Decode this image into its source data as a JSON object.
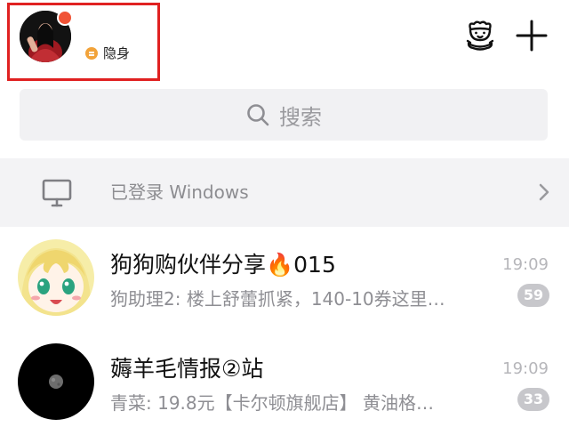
{
  "header": {
    "status_text": "隐身",
    "icons": {
      "avatar": "profile-photo",
      "notification_dot": "red-dot",
      "status": "invisible-status-icon",
      "mascot": "mascot-icon",
      "add": "plus-icon"
    }
  },
  "search": {
    "placeholder": "搜索",
    "icon": "search-icon"
  },
  "login_banner": {
    "text": "已登录 Windows",
    "icon": "monitor-icon",
    "chevron": "chevron-right-icon"
  },
  "chats": [
    {
      "title": "狗狗购伙伴分享🔥015",
      "preview": "狗助理2: 楼上舒蕾抓紧，140-10券这里…",
      "time": "19:09",
      "unread": "59",
      "avatar": "anime-girl-avatar"
    },
    {
      "title": "薅羊毛情报②站",
      "preview": "青菜: 19.8元【卡尔顿旗舰店】 黄油格…",
      "time": "19:09",
      "unread": "33",
      "avatar": "moon-avatar"
    }
  ],
  "colors": {
    "highlight_border": "#e02121",
    "search_bg": "#f1f1f3",
    "banner_bg": "#f3f3f5",
    "badge_bg": "#c7c7cb",
    "status_dot": "#f2a33a",
    "notification_dot": "#f05336"
  }
}
